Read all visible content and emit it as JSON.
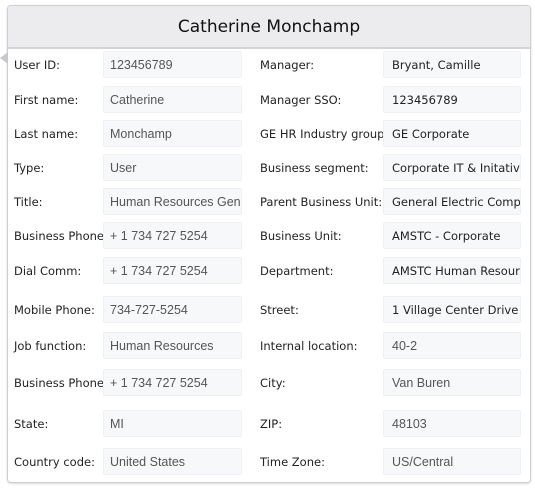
{
  "title": "Catherine Monchamp",
  "rows": [
    {
      "left_label": "User ID:",
      "left_value": "123456789",
      "right_label": "Manager:",
      "right_value": "Bryant, Camille",
      "right_style": "dark"
    },
    {
      "left_label": "First name:",
      "left_value": "Catherine",
      "right_label": "Manager SSO:",
      "right_value": "123456789",
      "right_style": "dark"
    },
    {
      "left_label": "Last name:",
      "left_value": "Monchamp",
      "right_label": "GE HR Industry group:",
      "right_value": "GE Corporate",
      "right_style": "dark"
    },
    {
      "left_label": "Type:",
      "left_value": "User",
      "right_label": "Business segment:",
      "right_value": "Corporate IT & Initatives",
      "right_style": "dark"
    },
    {
      "left_label": "Title:",
      "left_value": "Human Resources Generalist",
      "right_label": "Parent Business Unit:",
      "right_value": "General Electric Company",
      "right_style": "dark"
    },
    {
      "left_label": "Business Phone:",
      "left_value": "+ 1 734 727 5254",
      "right_label": "Business Unit:",
      "right_value": "AMSTC - Corporate",
      "right_style": "dark"
    },
    {
      "left_label": "Dial Comm:",
      "left_value": "+ 1 734 727 5254",
      "right_label": "Department:",
      "right_value": "AMSTC Human Resources",
      "right_style": "dark"
    },
    {
      "left_label": "Mobile Phone:",
      "left_value": "734-727-5254",
      "right_label": "Street:",
      "right_value": "1 Village Center Drive",
      "right_style": "dark"
    },
    {
      "left_label": "Job function:",
      "left_value": "Human Resources",
      "right_label": "Internal location:",
      "right_value": "40-2",
      "right_style": "grey"
    },
    {
      "left_label": "Business Phone:",
      "left_value": "+ 1 734 727 5254",
      "right_label": "City:",
      "right_value": "Van Buren",
      "right_style": "grey"
    },
    {
      "left_label": "State:",
      "left_value": "MI",
      "right_label": "ZIP:",
      "right_value": "48103",
      "right_style": "grey"
    },
    {
      "left_label": "Country code:",
      "left_value": "United States",
      "right_label": "Time Zone:",
      "right_value": "US/Central",
      "right_style": "grey"
    }
  ]
}
